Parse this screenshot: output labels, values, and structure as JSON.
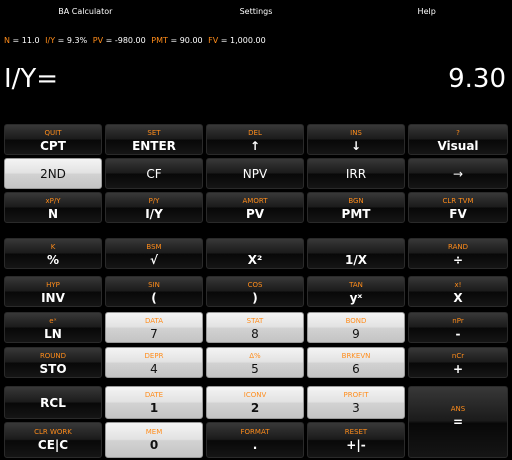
{
  "menubar": {
    "calculator": "BA Calculator",
    "settings": "Settings",
    "help": "Help"
  },
  "status": [
    {
      "label": "N",
      "value": "11.0"
    },
    {
      "label": "I/Y",
      "value": "9.3%"
    },
    {
      "label": "PV",
      "value": "-980.00"
    },
    {
      "label": "PMT",
      "value": "90.00"
    },
    {
      "label": "FV",
      "value": "1,000.00"
    }
  ],
  "display": {
    "label": "I/Y=",
    "value": "9.30"
  },
  "colors": {
    "secondary": "#ff8c1a",
    "background": "#000000"
  },
  "keys": {
    "cpt": {
      "sec": "QUIT",
      "pri": "CPT"
    },
    "enter": {
      "sec": "SET",
      "pri": "ENTER"
    },
    "up": {
      "sec": "DEL",
      "pri": "↑"
    },
    "down": {
      "sec": "INS",
      "pri": "↓"
    },
    "visual": {
      "sec": "?",
      "pri": "Visual"
    },
    "second": {
      "pri": "2ND"
    },
    "cf": {
      "pri": "CF"
    },
    "npv": {
      "pri": "NPV"
    },
    "irr": {
      "pri": "IRR"
    },
    "arrow": {
      "pri": "→"
    },
    "n": {
      "sec": "xP/Y",
      "pri": "N"
    },
    "iy": {
      "sec": "P/Y",
      "pri": "I/Y"
    },
    "pv": {
      "sec": "AMORT",
      "pri": "PV"
    },
    "pmt": {
      "sec": "BGN",
      "pri": "PMT"
    },
    "fv": {
      "sec": "CLR TVM",
      "pri": "FV"
    },
    "percent": {
      "sec": "K",
      "pri": "%"
    },
    "sqrt": {
      "sec": "BSM",
      "pri": "√"
    },
    "square": {
      "sec": "",
      "pri": "X²"
    },
    "recip": {
      "sec": "",
      "pri": "1/X"
    },
    "divide": {
      "sec": "RAND",
      "pri": "÷"
    },
    "inv": {
      "sec": "HYP",
      "pri": "INV"
    },
    "lparen": {
      "sec": "SIN",
      "pri": "("
    },
    "rparen": {
      "sec": "COS",
      "pri": ")"
    },
    "power": {
      "sec": "TAN",
      "pri": "yˣ"
    },
    "multiply": {
      "sec": "x!",
      "pri": "X"
    },
    "ln": {
      "sec": "eˣ",
      "pri": "LN"
    },
    "k7": {
      "sec": "DATA",
      "pri": "7"
    },
    "k8": {
      "sec": "STAT",
      "pri": "8"
    },
    "k9": {
      "sec": "BOND",
      "pri": "9"
    },
    "minus": {
      "sec": "nPr",
      "pri": "-"
    },
    "sto": {
      "sec": "ROUND",
      "pri": "STO"
    },
    "k4": {
      "sec": "DEPR",
      "pri": "4"
    },
    "k5": {
      "sec": "Δ%",
      "pri": "5"
    },
    "k6": {
      "sec": "BRKEVN",
      "pri": "6"
    },
    "plus": {
      "sec": "nCr",
      "pri": "+"
    },
    "rcl": {
      "pri": "RCL"
    },
    "k1": {
      "sec": "DATE",
      "pri": "1"
    },
    "k2": {
      "sec": "ICONV",
      "pri": "2"
    },
    "k3": {
      "sec": "PROFIT",
      "pri": "3"
    },
    "equals": {
      "sec": "ANS",
      "pri": "="
    },
    "cec": {
      "sec": "CLR WORK",
      "pri": "CE|C"
    },
    "k0": {
      "sec": "MEM",
      "pri": "0"
    },
    "dot": {
      "sec": "FORMAT",
      "pri": "."
    },
    "sign": {
      "sec": "RESET",
      "pri": "+|-"
    }
  }
}
